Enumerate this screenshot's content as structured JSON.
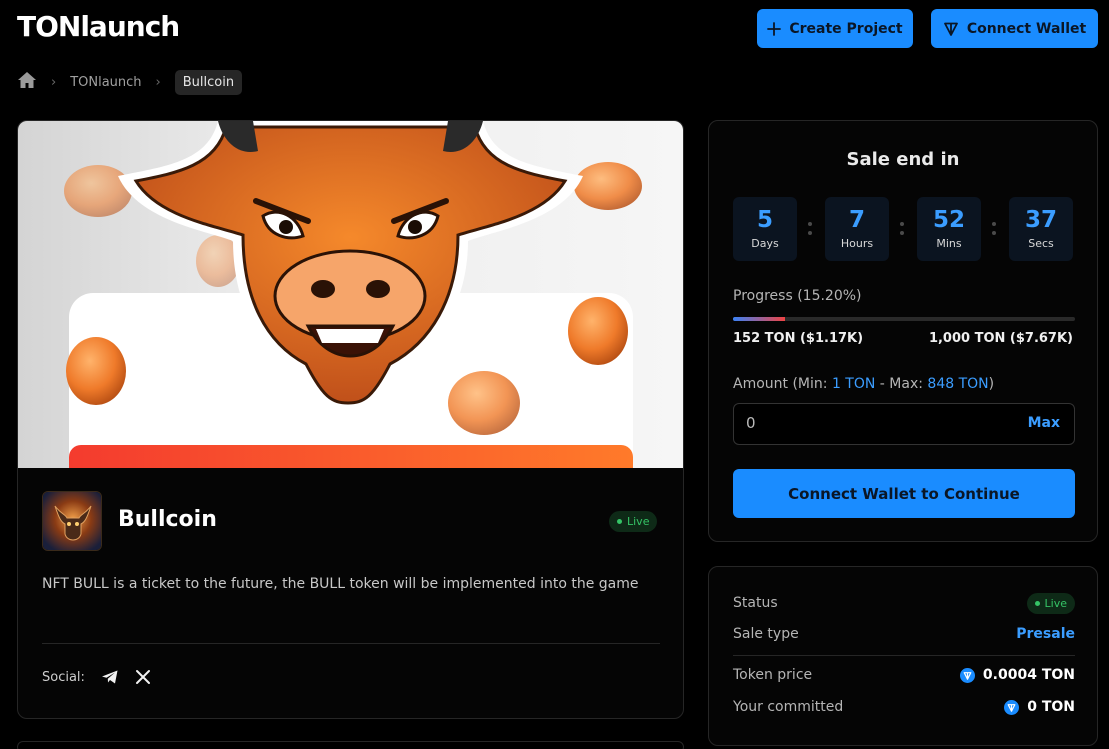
{
  "header": {
    "logo": "TONlaunch",
    "create_label": "Create Project",
    "connect_label": "Connect Wallet"
  },
  "breadcrumb": {
    "items": [
      "TONlaunch",
      "Bullcoin"
    ]
  },
  "project": {
    "name": "Bullcoin",
    "status": "Live",
    "description": "NFT BULL is a ticket to the future, the BULL token will be implemented into the game",
    "social_label": "Social:"
  },
  "sale": {
    "title": "Sale end in",
    "countdown": [
      {
        "value": "5",
        "label": "Days"
      },
      {
        "value": "7",
        "label": "Hours"
      },
      {
        "value": "52",
        "label": "Mins"
      },
      {
        "value": "37",
        "label": "Secs"
      }
    ],
    "progress_label": "Progress (15.20%)",
    "progress_fraction": 0.152,
    "raised": "152 TON ($1.17K)",
    "goal": "1,000 TON ($7.67K)",
    "amount_prefix": "Amount (Min: ",
    "amount_min": "1 TON",
    "amount_mid": " - Max: ",
    "amount_max": "848 TON",
    "amount_suffix": ")",
    "amount_placeholder": "0",
    "max_label": "Max",
    "continue_label": "Connect Wallet to Continue"
  },
  "details": {
    "status_key": "Status",
    "status_value": "Live",
    "sale_type_key": "Sale type",
    "sale_type_value": "Presale",
    "token_price_key": "Token price",
    "token_price_value": "0.0004 TON",
    "committed_key": "Your committed",
    "committed_value": "0 TON"
  },
  "colors": {
    "accent": "#1a8cff",
    "live": "#35c466",
    "background": "#000000"
  },
  "icons": [
    "plus-icon",
    "ton-logo-icon",
    "home-icon",
    "chevron-right-icon",
    "telegram-icon",
    "x-twitter-icon"
  ]
}
